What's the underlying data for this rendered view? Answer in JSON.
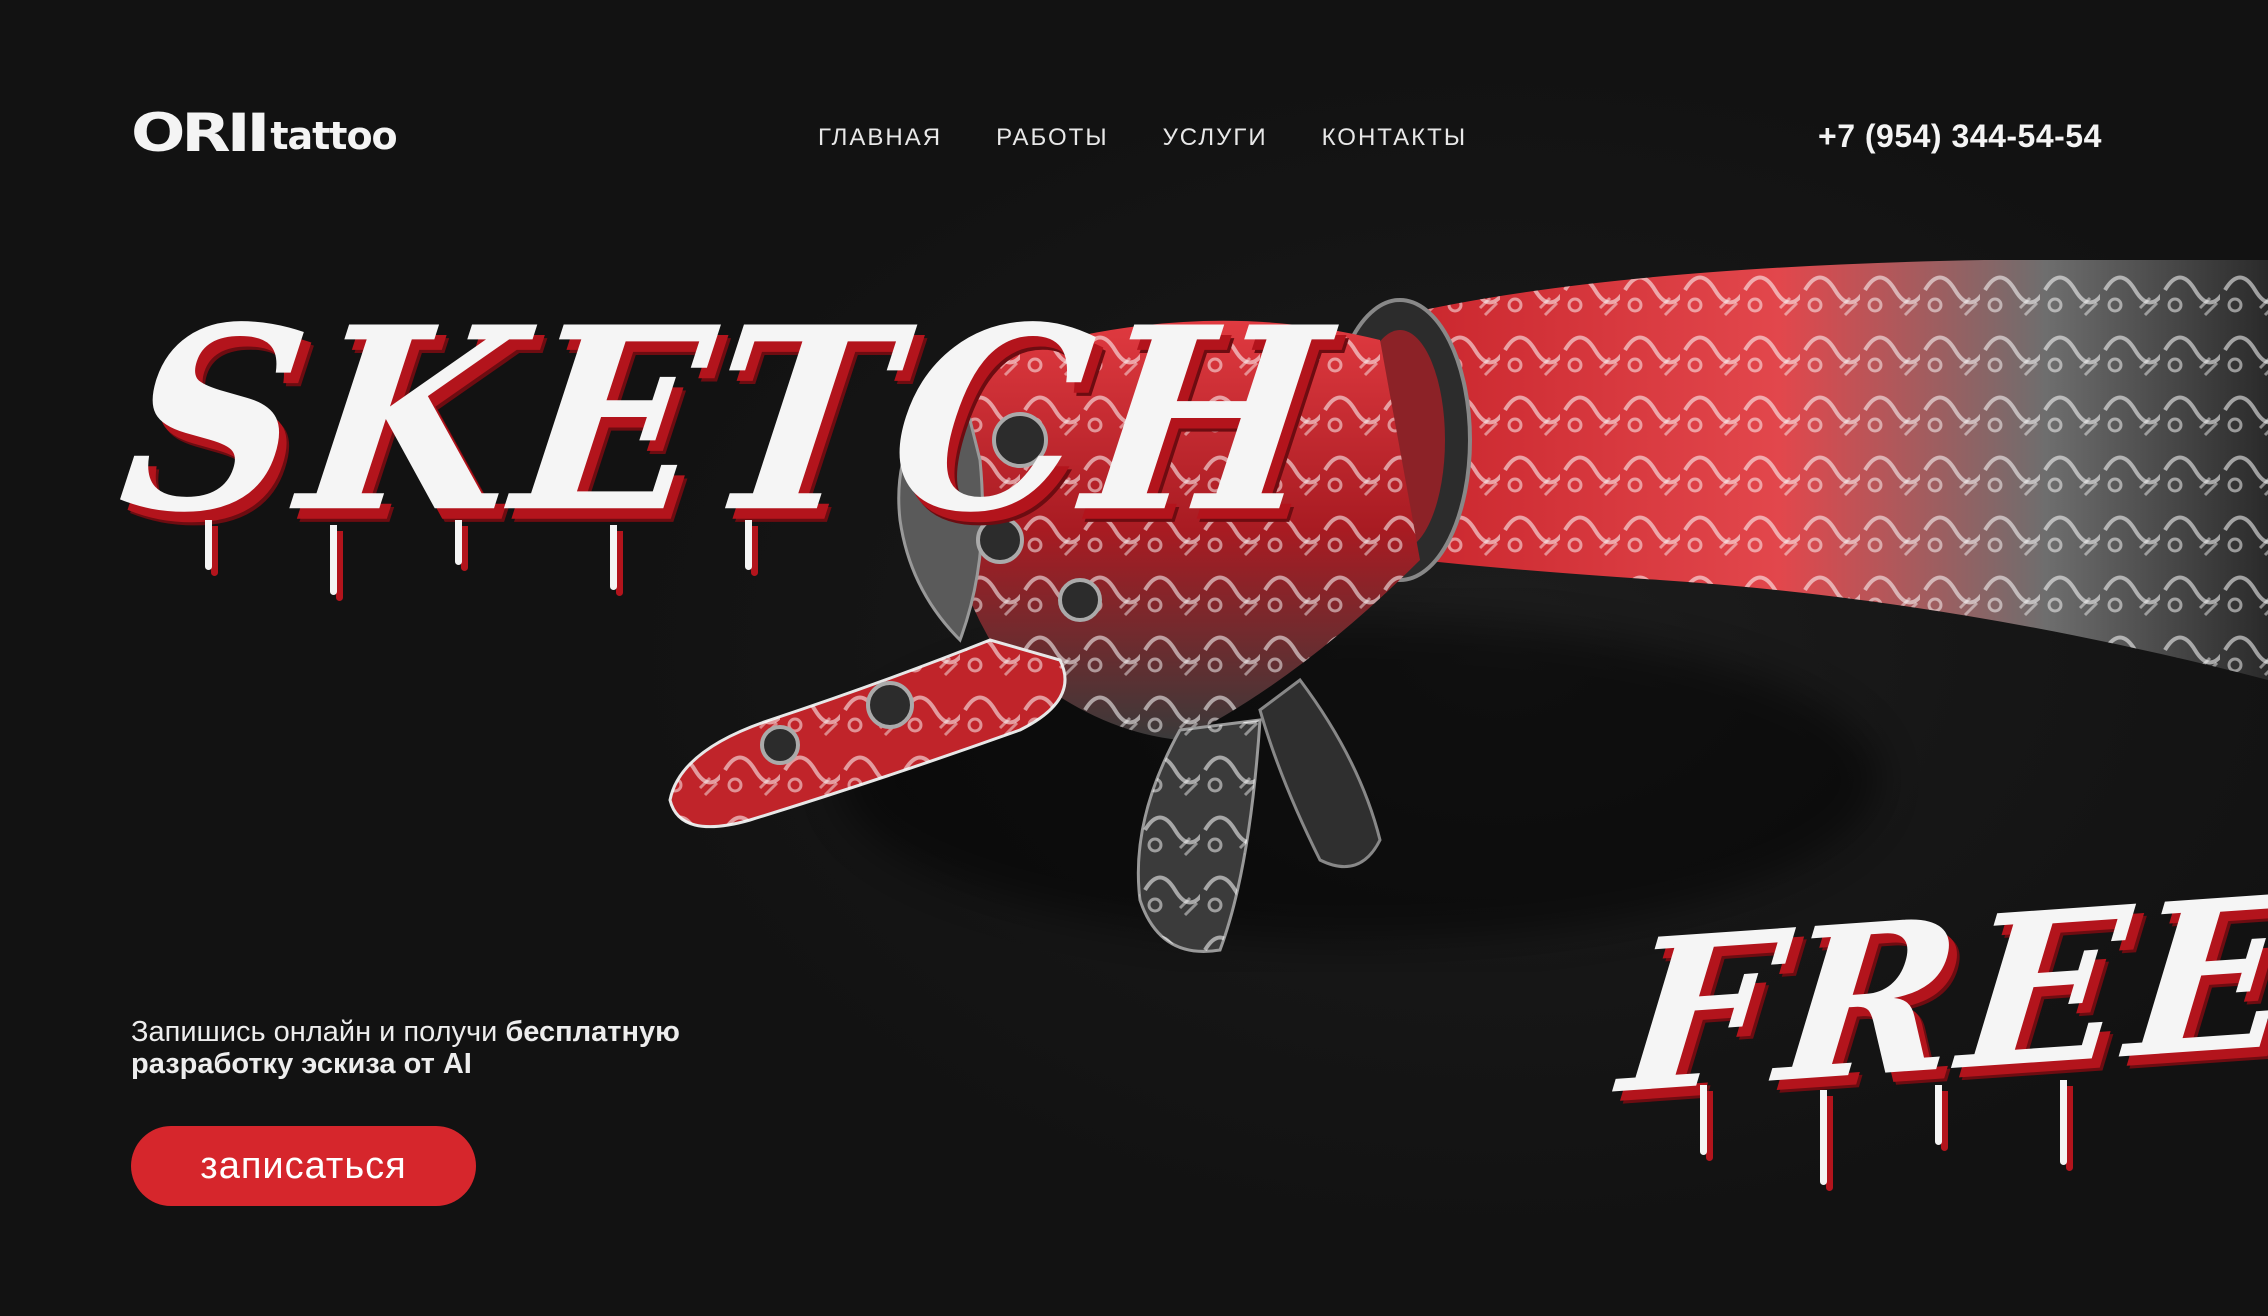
{
  "brand": {
    "logo_main": "ORII",
    "logo_sub": "tattoo"
  },
  "nav": {
    "items": [
      {
        "label": "ГЛАВНАЯ"
      },
      {
        "label": "РАБОТЫ"
      },
      {
        "label": "УСЛУГИ"
      },
      {
        "label": "КОНТАКТЫ"
      }
    ]
  },
  "phone": "+7 (954) 344-54-54",
  "hero": {
    "title_word": "SKETCH",
    "accent_word": "FREE",
    "tagline_regular": "Запишись онлайн и получи ",
    "tagline_bold_1": "бесплатную",
    "tagline_bold_2": "разработку эскиза от AI",
    "cta_label": "записаться"
  },
  "colors": {
    "background": "#141414",
    "accent": "#d6262c",
    "text": "#f2f2f2",
    "shadow_red": "#b3141c"
  },
  "icons": {
    "hero_illustration": "tattooed-robotic-hand-pointing-icon"
  }
}
